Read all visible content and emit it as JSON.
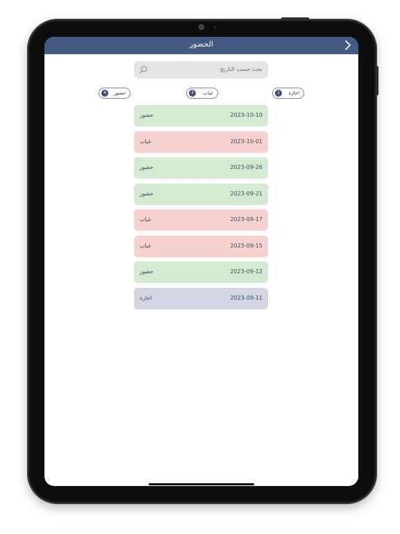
{
  "colors": {
    "navbar": "#435a82",
    "present": "#d4ebd2",
    "absent": "#f8d2d1",
    "leave": "#d3d7e1",
    "badge": "#3f5077"
  },
  "header": {
    "title": "الحضور",
    "back_icon": "chevron-right-icon"
  },
  "search": {
    "placeholder": "بحث حسب التاريخ",
    "icon": "search-icon"
  },
  "filters": [
    {
      "label": "حضور",
      "count": "4"
    },
    {
      "label": "غياب",
      "count": "3"
    },
    {
      "label": "اجازة",
      "count": "1"
    }
  ],
  "records": [
    {
      "date": "2023-10-10",
      "status": "حضور",
      "type": "present"
    },
    {
      "date": "2023-10-01",
      "status": "غياب",
      "type": "absent"
    },
    {
      "date": "2023-09-26",
      "status": "حضور",
      "type": "present"
    },
    {
      "date": "2023-09-21",
      "status": "حضور",
      "type": "present"
    },
    {
      "date": "2023-09-17",
      "status": "غياب",
      "type": "absent"
    },
    {
      "date": "2023-09-15",
      "status": "غياب",
      "type": "absent"
    },
    {
      "date": "2023-09-12",
      "status": "حضور",
      "type": "present"
    },
    {
      "date": "2023-09-11",
      "status": "اجازة",
      "type": "leave"
    }
  ]
}
